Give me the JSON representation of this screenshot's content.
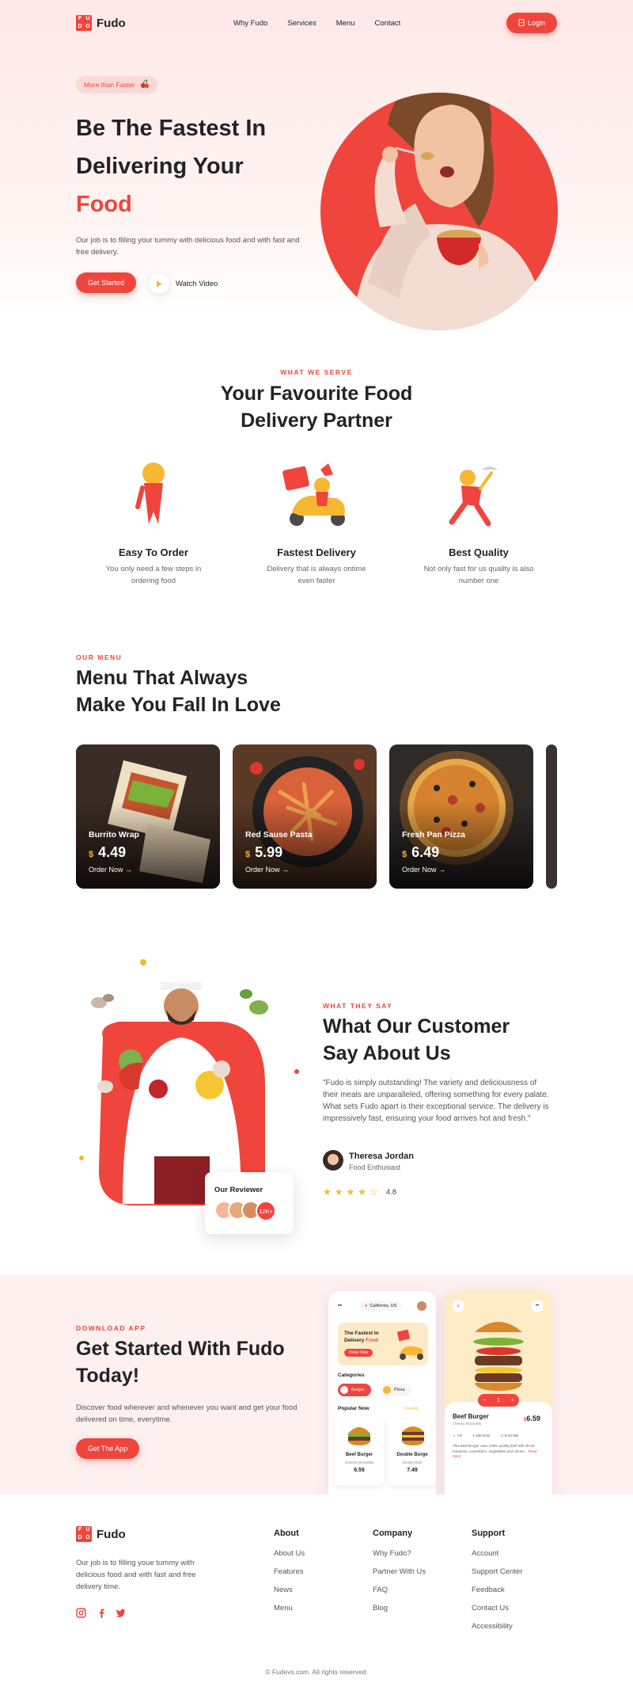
{
  "brand": {
    "name": "Fudo",
    "mark_letters": [
      "F",
      "U",
      "D",
      "O"
    ],
    "accent": "#f0453d"
  },
  "nav": {
    "items": [
      "Why Fudo",
      "Services",
      "Menu",
      "Contact"
    ],
    "login_label": "Login"
  },
  "hero": {
    "pill": "More than Faster",
    "title_line1": "Be The Fastest In",
    "title_line2": "Delivering Your",
    "title_line3": "Food",
    "description": "Our job is to filling your tummy with delicious food and with fast and free delivery.",
    "cta_label": "Get Started",
    "watch_label": "Watch Video"
  },
  "serve": {
    "eyebrow": "WHAT WE SERVE",
    "title_line1": "Your Favourite Food",
    "title_line2": "Delivery Partner",
    "features": [
      {
        "title": "Easy To Order",
        "desc_line1": "You only need a few steps in",
        "desc_line2": "ordering food"
      },
      {
        "title": "Fastest Delivery",
        "desc_line1": "Delivery that is always ontime",
        "desc_line2": "even faster"
      },
      {
        "title": "Best Quality",
        "desc_line1": "Not only fast for us quality is also",
        "desc_line2": "number one"
      }
    ]
  },
  "menu": {
    "eyebrow": "OUR MENU",
    "title_line1": "Menu That Always",
    "title_line2": "Make You Fall In Love",
    "items": [
      {
        "name": "Burrito Wrap",
        "currency": "$",
        "price": "4.49",
        "order_label": "Order Now →"
      },
      {
        "name": "Red Sause Pasta",
        "currency": "$",
        "price": "5.99",
        "order_label": "Order Now →"
      },
      {
        "name": "Fresh Pan Pizza",
        "currency": "$",
        "price": "6.49",
        "order_label": "Order Now →"
      }
    ]
  },
  "testimonial": {
    "eyebrow": "WHAT THEY SAY",
    "title_line1": "What Our Customer",
    "title_line2": "Say About Us",
    "quote": "\"Fudo is simply outstanding! The variety and deliciousness of their meals are unparalleled, offering something for every palate. What sets Fudo apart is their exceptional service. The delivery is impressively fast, ensuring your food arrives hot and fresh.\"",
    "reviewer_name": "Theresa Jordan",
    "reviewer_role": "Food Enthusiast",
    "rating": "4.8",
    "rating_value": 4.5,
    "reviewer_card_title": "Our Reviewer",
    "reviewer_count": "12K+"
  },
  "app": {
    "eyebrow": "DOWNLOAD APP",
    "title_line1": "Get Started With Fudo",
    "title_line2": "Today!",
    "description": "Discover food wherever and whenever you want and get your food delivered on time, everytime.",
    "cta_label": "Get The App",
    "phone1": {
      "location": "California, US",
      "banner_line1": "The Fastest In",
      "banner_line2": "Delivery",
      "banner_highlight": "Food",
      "banner_button": "Order Now",
      "categories_label": "Categories",
      "categories": [
        "Burger",
        "Pizza"
      ],
      "popular_label": "Popular Now",
      "view_all": "View All",
      "items": [
        {
          "name": "Beef Burger",
          "sub": "Cheesy Mozarella",
          "price": "6.59"
        },
        {
          "name": "Double Burge",
          "sub": "Double Beef",
          "price": "7.49"
        }
      ]
    },
    "phone2": {
      "qty": "1",
      "name": "Beef Burger",
      "sub": "Cheesy Mozarella",
      "price": "6.59",
      "rating": "4.8",
      "kcal": "150 Kcal",
      "time": "5-10 Min",
      "desc": "This Beef Burger uses 100% quality beef with sliced tomatoes, cucumbers, vegetables and onions...",
      "read_more": "Read More"
    }
  },
  "footer": {
    "description": "Our job is to filling youe tummy with delicious food and with fast and free delivery time.",
    "columns": [
      {
        "title": "About",
        "items": [
          "About Us",
          "Features",
          "News",
          "Menu"
        ]
      },
      {
        "title": "Company",
        "items": [
          "Why Fudo?",
          "Partner With Us",
          "FAQ",
          "Blog"
        ]
      },
      {
        "title": "Support",
        "items": [
          "Account",
          "Support Center",
          "Feedback",
          "Contact Us",
          "Accessibility"
        ]
      }
    ],
    "copyright": "© Fudevs.com. All rights reserved."
  }
}
